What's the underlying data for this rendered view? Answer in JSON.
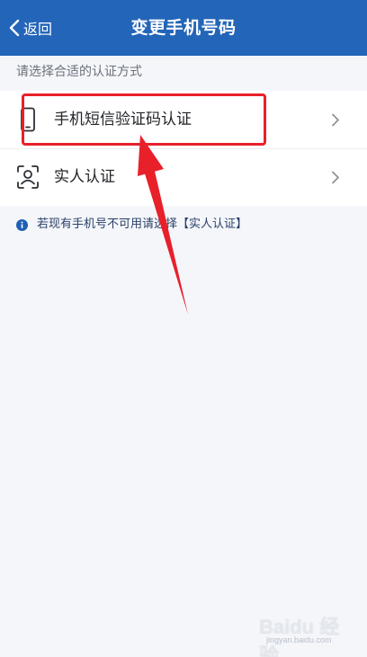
{
  "header": {
    "back_label": "返回",
    "title": "变更手机号码",
    "background": "#2365b8"
  },
  "prompt": "请选择合适的认证方式",
  "options": [
    {
      "icon": "phone-icon",
      "label": "手机短信验证码认证"
    },
    {
      "icon": "face-scan-icon",
      "label": "实人认证"
    }
  ],
  "notice": {
    "icon": "info-icon",
    "text": "若现有手机号不可用请选择【实人认证】"
  },
  "annotation": {
    "color": "#e8202a",
    "highlights": "手机短信验证码认证"
  },
  "watermark": {
    "text": "Baidu 经验",
    "sub": "jingyan.baidu.com"
  }
}
